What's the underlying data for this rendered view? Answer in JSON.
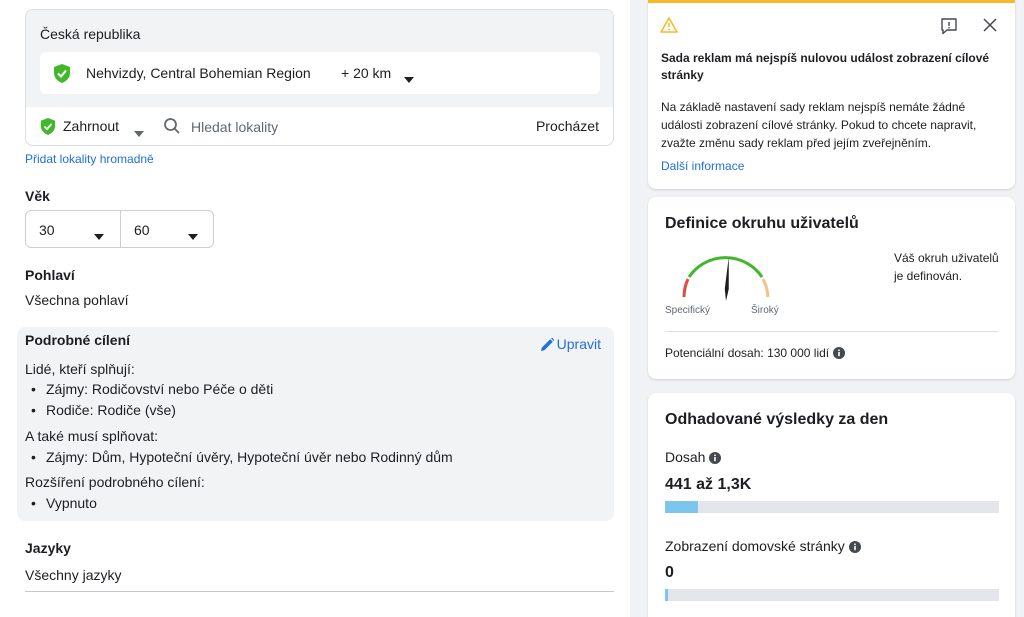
{
  "location": {
    "country": "Česká republika",
    "item_name": "Nehvizdy, Central Bohemian Region",
    "item_radius": "+ 20 km",
    "include_label": "Zahrnout",
    "search_placeholder": "Hledat lokality",
    "browse_label": "Procházet",
    "bulk_link": "Přidat lokality hromadně"
  },
  "age": {
    "label": "Věk",
    "min": "30",
    "max": "60"
  },
  "gender": {
    "label": "Pohlaví",
    "value": "Všechna pohlaví"
  },
  "detailed": {
    "title": "Podrobné cílení",
    "edit_label": "Upravit",
    "match_label": "Lidé, kteří splňují:",
    "match_items": [
      "Zájmy: Rodičovství nebo Péče o děti",
      "Rodiče: Rodiče (vše)"
    ],
    "must_label": "A také musí splňovat:",
    "must_items": [
      "Zájmy: Dům, Hypoteční úvěry, Hypoteční úvěr nebo Rodinný dům"
    ],
    "expansion_label": "Rozšíření podrobného cílení:",
    "expansion_items": [
      "Vypnuto"
    ]
  },
  "languages": {
    "label": "Jazyky",
    "value": "Všechny jazyky"
  },
  "warning": {
    "headline": "Sada reklam má nejspíš nulovou událost zobrazení cílové stránky",
    "body": "Na základě nastavení sady reklam nejspíš nemáte žádné události zobrazení cílové stránky. Pokud to chcete napravit, zvažte změnu sady reklam před jejím zveřejněním.",
    "more_link": "Další informace"
  },
  "audience": {
    "title": "Definice okruhu uživatelů",
    "specific_label": "Specifický",
    "broad_label": "Široký",
    "status": "Váš okruh uživatelů je definován.",
    "potential_reach": "Potenciální dosah: 130 000 lidí",
    "gauge_level": 0.52
  },
  "estimates": {
    "title": "Odhadované výsledky za den",
    "metrics": [
      {
        "label": "Dosah",
        "value": "441 až 1,3K",
        "fill_fraction": 0.1
      },
      {
        "label": "Zobrazení domovské stránky",
        "value": "0",
        "fill_fraction": 0.01
      }
    ]
  },
  "colors": {
    "link": "#216fdb",
    "shield": "#42b72a",
    "warning_accent": "#f7b928",
    "bar_fill": "#7cc5ec"
  }
}
